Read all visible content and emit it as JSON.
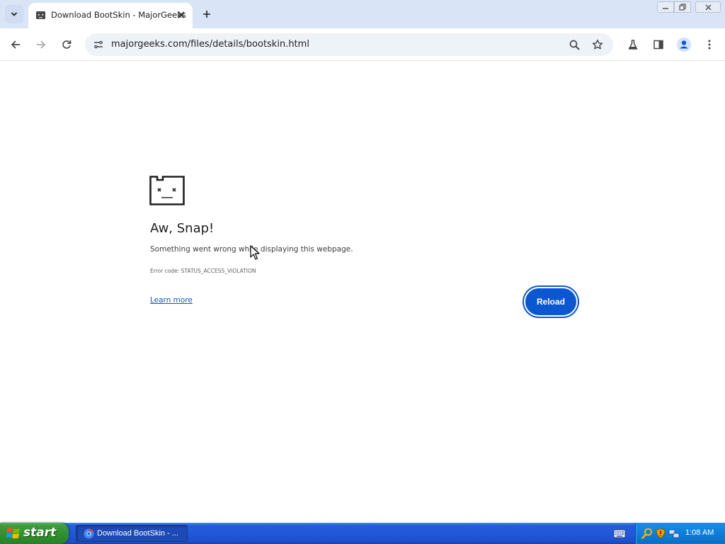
{
  "browser": {
    "tab": {
      "title": "Download BootSkin - MajorGeeks",
      "favicon": "sad-tab-icon"
    },
    "address_bar": {
      "url": "majorgeeks.com/files/details/bootskin.html"
    },
    "toolbar_icons": [
      "back-arrow-icon",
      "forward-arrow-icon",
      "reload-icon",
      "site-info-icon",
      "search-icon",
      "star-icon",
      "labs-flask-icon",
      "side-panel-icon",
      "profile-icon",
      "menu-dots-icon"
    ]
  },
  "error_page": {
    "icon": "sad-face-icon",
    "title": "Aw, Snap!",
    "message": "Something went wrong while displaying this webpage.",
    "error_code": "Error code: STATUS_ACCESS_VIOLATION",
    "learn_more": "Learn more",
    "reload_label": "Reload",
    "accent_color": "#0b57d0"
  },
  "taskbar": {
    "start_label": "start",
    "task_item_label": "Download BootSkin - ...",
    "clock": "1:08 AM",
    "tray_icons": [
      "search-icon",
      "shield-icon",
      "network-icon"
    ]
  }
}
